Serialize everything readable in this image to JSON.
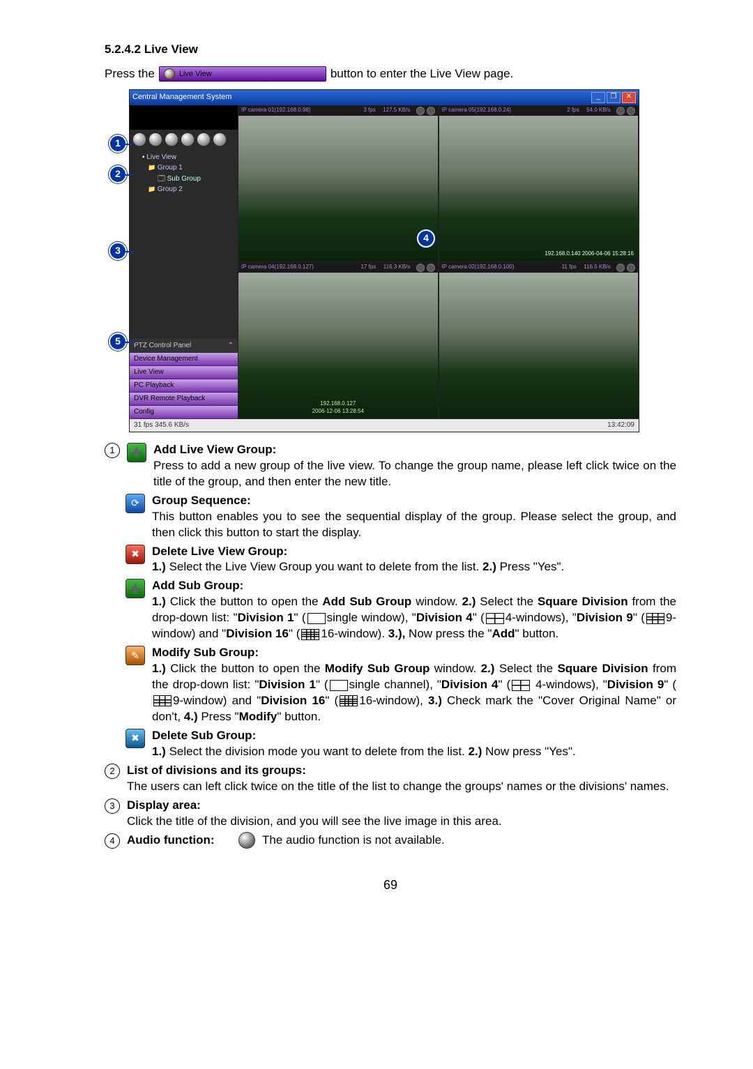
{
  "section": {
    "number": "5.2.4.2",
    "title": "Live View"
  },
  "intro": {
    "before": "Press the",
    "button_label": "Live View",
    "after": "button to enter the Live View page."
  },
  "app": {
    "title": "Central Management System",
    "tree": {
      "root": "Live View",
      "g1": "Group 1",
      "g1_sub": "Sub Group",
      "g2": "Group 2"
    },
    "ptz_title": "PTZ Control Panel",
    "menu": [
      "Device Management",
      "Live View",
      "PC Playback",
      "DVR Remote Playback",
      "Config"
    ],
    "status_left": "31 fps 345.6 KB/s",
    "status_right": "13:42:09",
    "panes": [
      {
        "name": "IP camera 01(192.168.0.98)",
        "fps": "3 fps",
        "rate": "127.5 KB/s",
        "ts": ""
      },
      {
        "name": "IP camera 05(192.168.0.24)",
        "fps": "2 fps",
        "rate": "54.0 KB/s",
        "corner": "192.168.0.140\n2006-04-06 15:28:16"
      },
      {
        "name": "IP camera 04(192.168.0.127)",
        "fps": "17 fps",
        "rate": "116.3 KB/s",
        "ts": "192.168.0.127\n2006-12-06 13:28:54"
      },
      {
        "name": "IP camera 02(192.168.0.100)",
        "fps": "11 fps",
        "rate": "116.5 KB/s",
        "ts": ""
      }
    ]
  },
  "callouts": {
    "c1": "1",
    "c2": "2",
    "c3": "3",
    "c4": "4",
    "c5": "5"
  },
  "anno": {
    "n1": "1",
    "n2": "2",
    "n3": "3",
    "n4": "4",
    "addGroup_t": "Add Live View Group:",
    "addGroup_b": "Press to add a new group of the live view. To change the group name, please left click twice on the title of the group, and then enter the new title.",
    "seq_t": "Group Sequence:",
    "seq_b": "This button enables you to see the sequential display of the group. Please select the group, and then click this button to start the display.",
    "delGroup_t": "Delete Live View Group:",
    "delGroup_b1": "1.)",
    "delGroup_b2": " Select the Live View Group you want to delete from the list. ",
    "delGroup_b3": "2.)",
    "delGroup_b4": " Press \"Yes\".",
    "addSub_t": "Add Sub Group:",
    "addSub_1a": "1.)",
    "addSub_1b": " Click the button to open the ",
    "addSub_1c": "Add Sub Group",
    "addSub_1d": " window. ",
    "addSub_2a": "2.)",
    "addSub_2b": " Select the ",
    "addSub_2c": "Square Division",
    "addSub_2d": " from the drop-down list: \"",
    "addSub_d1": "Division 1",
    "addSub_d1b": "\" (",
    "addSub_d1c": "single window), \"",
    "addSub_d4": "Division 4",
    "addSub_d4b": "\" (",
    "addSub_d4c": "4-windows), \"",
    "addSub_d9": "Division 9",
    "addSub_d9b": "\" (",
    "addSub_d9c": "9-window) and \"",
    "addSub_d16": "Division 16",
    "addSub_d16b": "\" (",
    "addSub_d16c": "16-window). ",
    "addSub_3a": "3.),",
    "addSub_3b": " Now press the \"",
    "addSub_3c": "Add",
    "addSub_3d": "\" button.",
    "modSub_t": "Modify Sub Group:",
    "modSub_1a": "1.)",
    "modSub_1b": " Click the button to open the ",
    "modSub_1c": "Modify Sub Group",
    "modSub_1d": " window. ",
    "modSub_2a": "2.)",
    "modSub_2b": " Select the ",
    "modSub_2c": "Square Division",
    "modSub_2d": " from the drop-down list: \"",
    "modSub_d1": "Division 1",
    "modSub_d1b": "\" (",
    "modSub_d1c": "single channel), \"",
    "modSub_d4": "Division 4",
    "modSub_d4b": "\" (",
    "modSub_d4c": " 4-windows), \"",
    "modSub_d9": "Division 9",
    "modSub_d9b": "\" (",
    "modSub_d9c": "9-window) and \"",
    "modSub_d16": "Division 16",
    "modSub_d16b": "\" (",
    "modSub_d16c": "16-window), ",
    "modSub_3a": "3.)",
    "modSub_3b": " Check mark the \"Cover Original Name\" or don't, ",
    "modSub_4a": "4.)",
    "modSub_4b": " Press \"",
    "modSub_4c": "Modify",
    "modSub_4d": "\" button.",
    "delSub_t": "Delete Sub Group:",
    "delSub_1a": "1.)",
    "delSub_1b": " Select the division mode you want to delete from the list. ",
    "delSub_2a": "2.)",
    "delSub_2b": " Now press \"Yes\".",
    "list_t": "List of divisions and its groups:",
    "list_b": "The users can left click twice on the title of the list to change the groups' names or the divisions' names.",
    "disp_t": "Display area:",
    "disp_b": "Click the title of the division, and you will see the live image in this area.",
    "audio_t": "Audio function:",
    "audio_b": "The audio function is not available."
  },
  "page_number": "69"
}
